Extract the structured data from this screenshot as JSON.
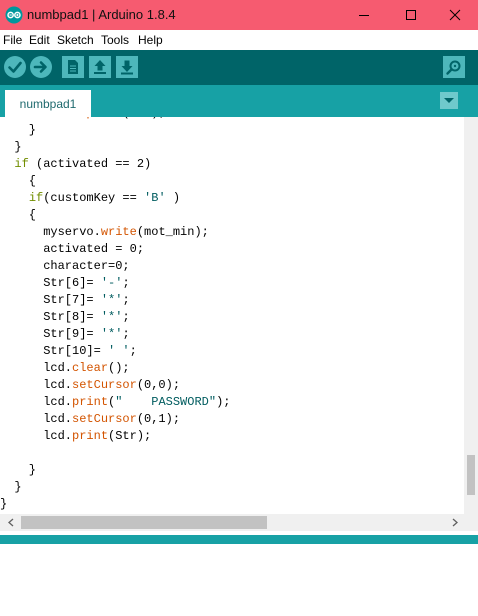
{
  "window": {
    "title": "numbpad1 | Arduino 1.8.4"
  },
  "menu": [
    "File",
    "Edit",
    "Sketch",
    "Tools",
    "Help"
  ],
  "tab": {
    "label": "numbpad1"
  },
  "colors": {
    "titlebar": "#f65b70",
    "toolbar": "#006468",
    "tabbar": "#17a1a5",
    "keyword": "#728e00",
    "function": "#d35400",
    "string": "#005c5f"
  },
  "icons": [
    "verify-icon",
    "upload-icon",
    "new-icon",
    "open-icon",
    "save-icon",
    "serial-monitor-icon",
    "tab-menu-icon"
  ],
  "code": [
    [
      {
        "t": "        lcd."
      },
      {
        "t": "print",
        "c": "fn"
      },
      {
        "t": "(Str);"
      }
    ],
    [
      {
        "t": "    }"
      }
    ],
    [
      {
        "t": "  }"
      }
    ],
    [
      {
        "t": "  "
      },
      {
        "t": "if",
        "c": "kw"
      },
      {
        "t": " (activated == 2)"
      }
    ],
    [
      {
        "t": "    {"
      }
    ],
    [
      {
        "t": "    "
      },
      {
        "t": "if",
        "c": "kw"
      },
      {
        "t": "(customKey == "
      },
      {
        "t": "'B'",
        "c": "str"
      },
      {
        "t": " )"
      }
    ],
    [
      {
        "t": "    {"
      }
    ],
    [
      {
        "t": "      myservo."
      },
      {
        "t": "write",
        "c": "fn"
      },
      {
        "t": "(mot_min);"
      }
    ],
    [
      {
        "t": "      activated = 0;"
      }
    ],
    [
      {
        "t": "      character=0;"
      }
    ],
    [
      {
        "t": "      Str[6]= "
      },
      {
        "t": "'-'",
        "c": "str"
      },
      {
        "t": ";"
      }
    ],
    [
      {
        "t": "      Str[7]= "
      },
      {
        "t": "'*'",
        "c": "str"
      },
      {
        "t": ";"
      }
    ],
    [
      {
        "t": "      Str[8]= "
      },
      {
        "t": "'*'",
        "c": "str"
      },
      {
        "t": ";"
      }
    ],
    [
      {
        "t": "      Str[9]= "
      },
      {
        "t": "'*'",
        "c": "str"
      },
      {
        "t": ";"
      }
    ],
    [
      {
        "t": "      Str[10]= "
      },
      {
        "t": "' '",
        "c": "str"
      },
      {
        "t": ";"
      }
    ],
    [
      {
        "t": "      lcd."
      },
      {
        "t": "clear",
        "c": "fn"
      },
      {
        "t": "();"
      }
    ],
    [
      {
        "t": "      lcd."
      },
      {
        "t": "setCursor",
        "c": "fn"
      },
      {
        "t": "(0,0);"
      }
    ],
    [
      {
        "t": "      lcd."
      },
      {
        "t": "print",
        "c": "fn"
      },
      {
        "t": "("
      },
      {
        "t": "\"    PASSWORD\"",
        "c": "str"
      },
      {
        "t": ");"
      }
    ],
    [
      {
        "t": "      lcd."
      },
      {
        "t": "setCursor",
        "c": "fn"
      },
      {
        "t": "(0,1);"
      }
    ],
    [
      {
        "t": "      lcd."
      },
      {
        "t": "print",
        "c": "fn"
      },
      {
        "t": "(Str);"
      }
    ],
    [
      {
        "t": ""
      }
    ],
    [
      {
        "t": "    }"
      }
    ],
    [
      {
        "t": "  }"
      }
    ],
    [
      {
        "t": "}"
      }
    ]
  ]
}
